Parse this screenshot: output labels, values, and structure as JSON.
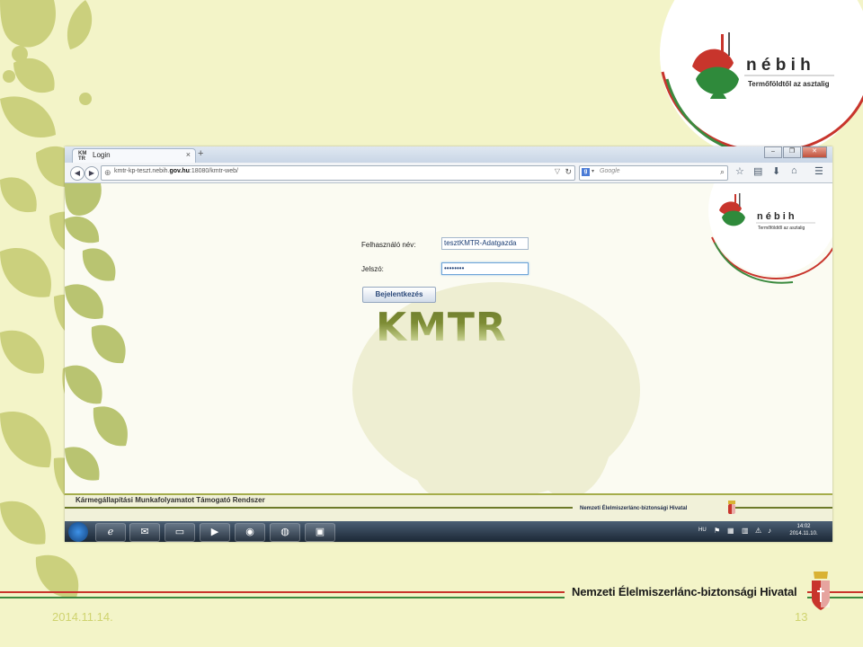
{
  "slide": {
    "date": "2014.11.14.",
    "page_number": "13",
    "footer_office": "Nemzeti Élelmiszerlánc-biztonsági Hivatal"
  },
  "logo": {
    "name": "n é b i h",
    "tagline": "Termőföldtől az asztalig"
  },
  "browser": {
    "tab_favicon_top": "KM",
    "tab_favicon_bottom": "TR",
    "tab_title": "Login",
    "tab_close": "×",
    "new_tab": "+",
    "url_prefix": "kmtr-kp-teszt.nebih.",
    "url_domain": "gov.hu",
    "url_suffix": ":18080/kmtr-web/",
    "search_engine": "g",
    "search_placeholder": "Google"
  },
  "login": {
    "username_label": "Felhasználó név:",
    "username_value": "tesztKMTR-Adatgazda",
    "password_label": "Jelszó:",
    "password_value": "••••••••",
    "submit_label": "Bejelentkezés",
    "app_logo": "KMTR"
  },
  "app_footer": {
    "system_name": "Kármegállapítási Munkafolyamatot Támogató Rendszer",
    "office_name": "Nemzeti Élelmiszerlánc-biztonsági Hivatal"
  },
  "taskbar": {
    "language": "HU",
    "time": "14:02",
    "date": "2014.11.10."
  },
  "colors": {
    "slide_background": "#f3f4c8",
    "leaf_decoration": "#c9ce7a",
    "brand_red": "#c8352c",
    "brand_green": "#2f8a3b",
    "footer_line_red": "#c8352c",
    "footer_line_green": "#3b8a3f"
  }
}
